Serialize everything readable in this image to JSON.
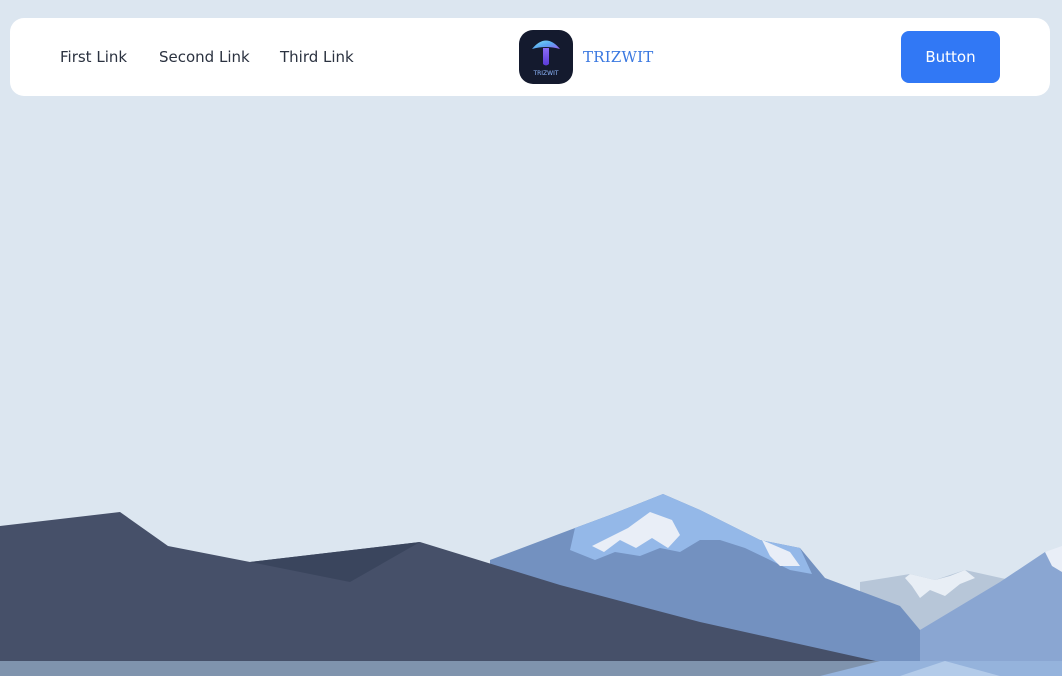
{
  "nav": {
    "links": [
      {
        "label": "First Link"
      },
      {
        "label": "Second Link"
      },
      {
        "label": "Third Link"
      }
    ],
    "brand": {
      "name": "TRIZWIT",
      "logo_text": "TRIZWIT"
    },
    "button_label": "Button"
  },
  "colors": {
    "background": "#dce6f0",
    "accent": "#3178f5",
    "brand_text": "#3a78e0"
  }
}
